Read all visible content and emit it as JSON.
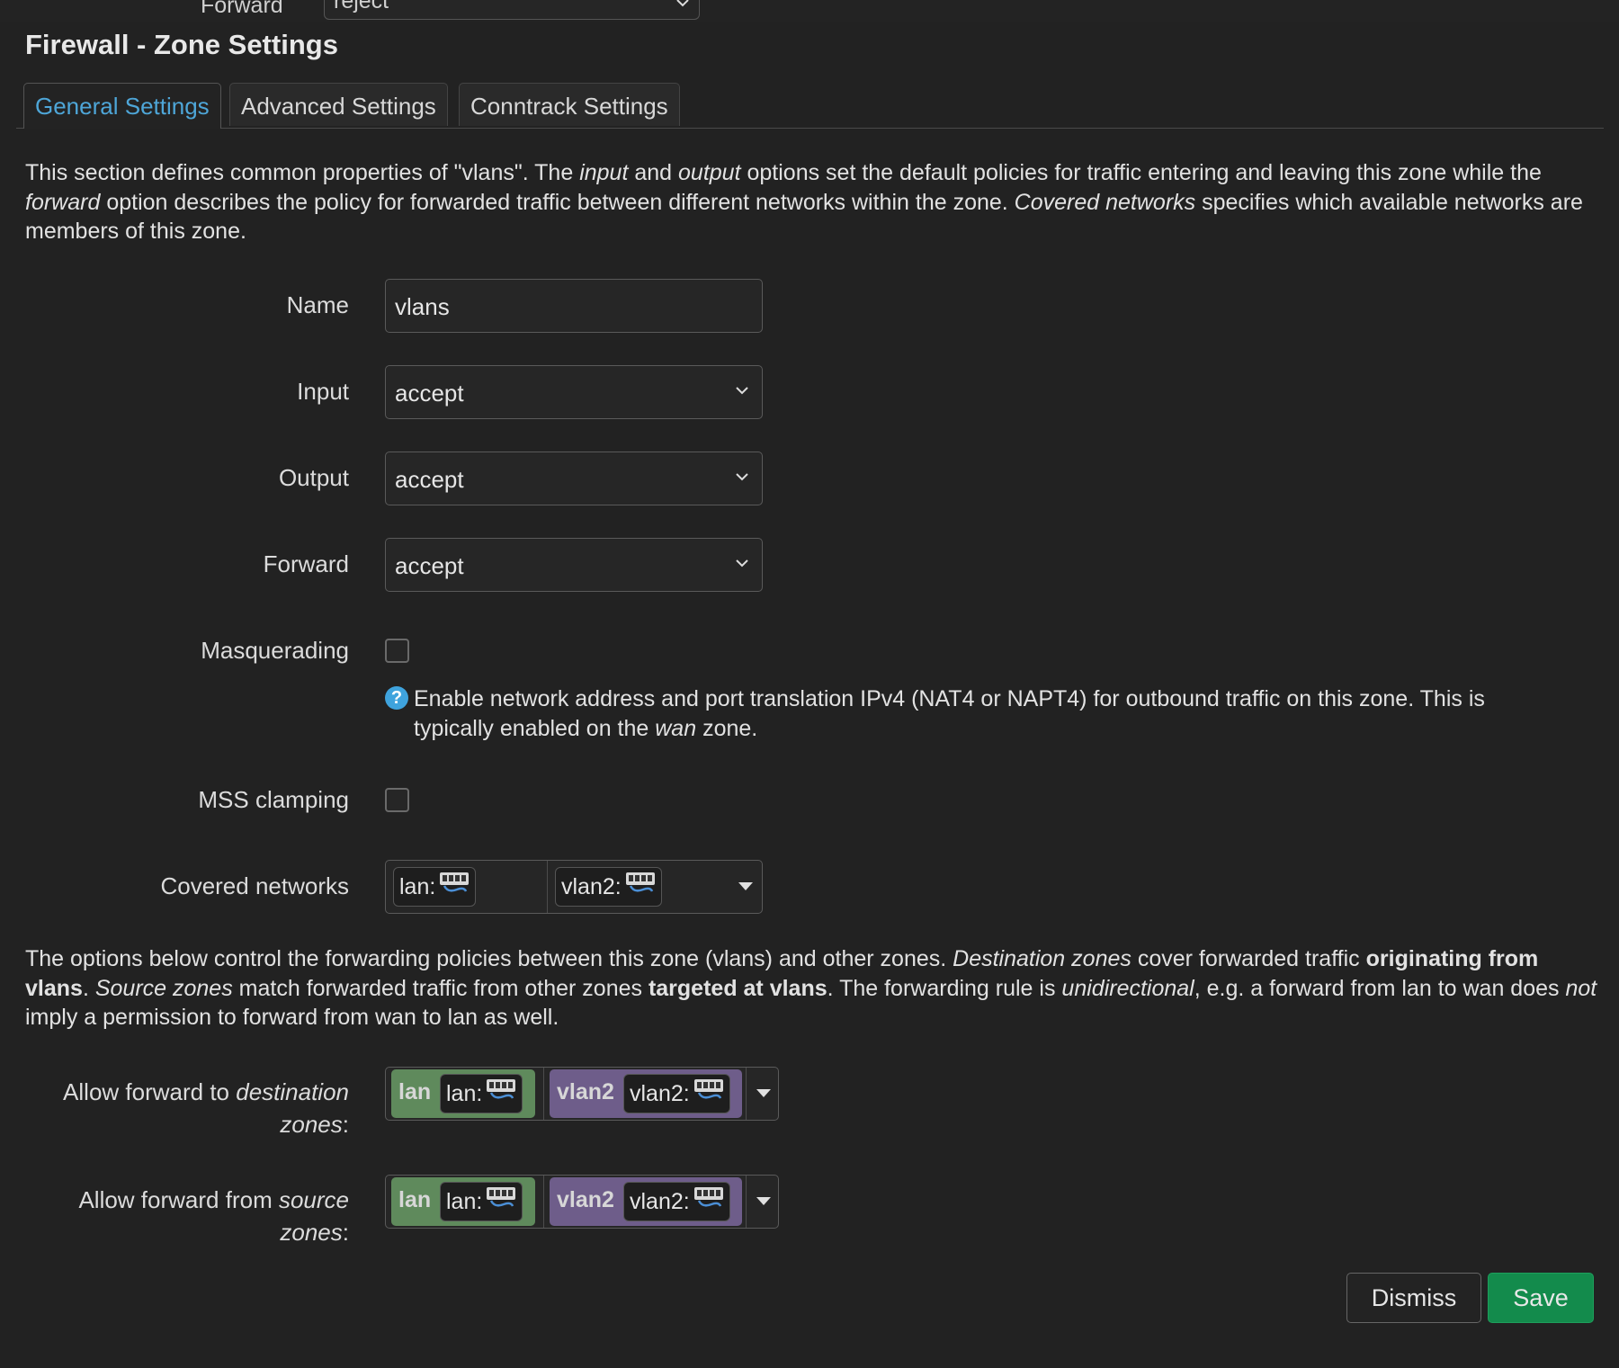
{
  "background_row": {
    "label": "Forward",
    "value": "reject"
  },
  "title": "Firewall - Zone Settings",
  "tabs": [
    {
      "label": "General Settings",
      "active": true
    },
    {
      "label": "Advanced Settings",
      "active": false
    },
    {
      "label": "Conntrack Settings",
      "active": false
    }
  ],
  "intro": {
    "p1": "This section defines common properties of \"vlans\". The ",
    "em1": "input",
    "p2": " and ",
    "em2": "output",
    "p3": " options set the default policies for traffic entering and leaving this zone while the ",
    "em3": "forward",
    "p4": " option describes the policy for forwarded traffic between different networks within the zone. ",
    "em4": "Covered networks",
    "p5": " specifies which available networks are members of this zone."
  },
  "form": {
    "name": {
      "label": "Name",
      "value": "vlans"
    },
    "input": {
      "label": "Input",
      "value": "accept"
    },
    "output": {
      "label": "Output",
      "value": "accept"
    },
    "forward": {
      "label": "Forward",
      "value": "accept"
    },
    "masquerading": {
      "label": "Masquerading",
      "checked": false,
      "help1": "Enable network address and port translation IPv4 (NAT4 or NAPT4) for outbound traffic on this zone. This is typically enabled on the ",
      "help_em": "wan",
      "help2": " zone."
    },
    "mss_clamping": {
      "label": "MSS clamping",
      "checked": false
    },
    "covered_networks": {
      "label": "Covered networks",
      "items": [
        "lan:",
        "vlan2:"
      ]
    }
  },
  "forwarding_desc": {
    "p1": "The options below control the forwarding policies between this zone (vlans) and other zones. ",
    "em1": "Destination zones",
    "p2": " cover forwarded traffic ",
    "b1": "originating from vlans",
    "p3": ". ",
    "em2": "Source zones",
    "p4": " match forwarded traffic from other zones ",
    "b2": "targeted at vlans",
    "p5": ". The forwarding rule is ",
    "em3": "unidirectional",
    "p6": ", e.g. a forward from lan to wan does ",
    "em4": "not",
    "p7": " imply a permission to forward from wan to lan as well."
  },
  "forward_dest": {
    "label_pre": "Allow forward to ",
    "label_em": "destination zones",
    "label_post": ":",
    "zones": [
      {
        "zone": "lan",
        "net": "lan:"
      },
      {
        "zone": "vlan2",
        "net": "vlan2:"
      }
    ]
  },
  "forward_src": {
    "label_pre": "Allow forward from ",
    "label_em": "source zones",
    "label_post": ":",
    "zones": [
      {
        "zone": "lan",
        "net": "lan:"
      },
      {
        "zone": "vlan2",
        "net": "vlan2:"
      }
    ]
  },
  "buttons": {
    "dismiss": "Dismiss",
    "save": "Save"
  },
  "icons": {
    "chevron": "chevron-down-icon",
    "network": "network-ports-icon",
    "help": "help-icon"
  },
  "colors": {
    "accent": "#4ea6d8",
    "save": "#138b4c",
    "zone_lan": "#5f8a5c",
    "zone_vlan2": "#6e5d8a"
  }
}
